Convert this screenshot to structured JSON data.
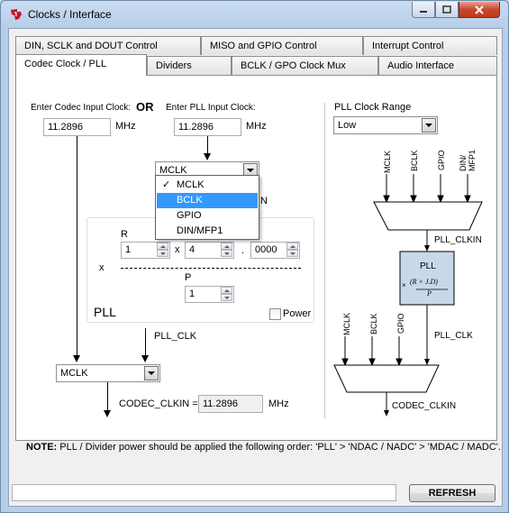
{
  "window": {
    "title": "Clocks / Interface"
  },
  "tabs_row1": [
    "DIN, SCLK and DOUT Control",
    "MISO and GPIO Control",
    "Interrupt Control"
  ],
  "tabs_row2": [
    "Codec Clock / PLL",
    "Dividers",
    "BCLK / GPO Clock Mux",
    "Audio Interface"
  ],
  "codec_input": {
    "label": "Enter Codec Input Clock:",
    "value": "11.2896",
    "unit": "MHz"
  },
  "or_label": "OR",
  "pll_input": {
    "label": "Enter PLL Input Clock:",
    "value": "11.2896",
    "unit": "MHz"
  },
  "pll_source_combo": {
    "value": "MCLK",
    "options": [
      "MCLK",
      "BCLK",
      "GPIO",
      "DIN/MFP1"
    ],
    "checked": "MCLK",
    "highlighted": "BCLK"
  },
  "pll_block": {
    "r_label": "R",
    "r_value": "1",
    "times": "x",
    "j_value": "4",
    "dot": ".",
    "d_value": "0000",
    "x_label": "x",
    "p_label": "P",
    "p_value": "1",
    "title": "PLL",
    "power_label": "Power",
    "power_checked": false,
    "partial_label": "N"
  },
  "pll_clk_label": "PLL_CLK",
  "codec_source_combo": {
    "value": "MCLK"
  },
  "codec_clkin": {
    "label": "CODEC_CLKIN =",
    "value": "11.2896",
    "unit": "MHz"
  },
  "pll_range": {
    "label": "PLL Clock Range",
    "value": "Low"
  },
  "diagram": {
    "mux_inputs_top": [
      "MCLK",
      "BCLK",
      "GPIO",
      "DIN/\nMFP1"
    ],
    "pll_clkin": "PLL_CLKIN",
    "pll_box_title": "PLL",
    "pll_formula": "(R × J.D)",
    "pll_formula_den": "P",
    "pll_formula_x": "×",
    "mux_inputs_bottom": [
      "MCLK",
      "BCLK",
      "GPIO"
    ],
    "pll_clk": "PLL_CLK",
    "codec_clkin": "CODEC_CLKIN"
  },
  "note": {
    "bold": "NOTE:",
    "text": " PLL / Divider power should be applied the following order: 'PLL' > 'NDAC / NADC' > 'MDAC / MADC'."
  },
  "status_field": "",
  "refresh_label": "REFRESH",
  "colors": {
    "pll_fill": "#c8d8ea",
    "selection": "#3399ff"
  }
}
